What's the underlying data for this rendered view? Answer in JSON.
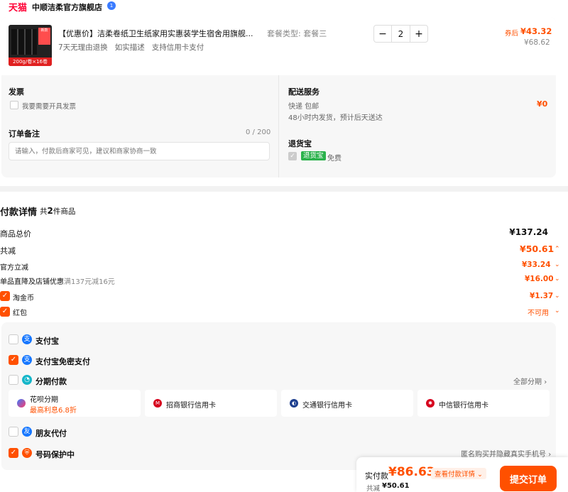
{
  "store": {
    "brand": "天猫",
    "name": "中顺洁柔官方旗舰店",
    "badge": "1"
  },
  "product": {
    "thumb_text": "200g/卷×16卷",
    "title": "【优惠价】洁柔卷纸卫生纸家用实惠装学生宿舍用旗舰...",
    "tags": "7天无理由退换   如实描述   支持信用卡支付",
    "package": "套餐类型: 套餐三",
    "quantity": "2",
    "coupon_label": "券后",
    "price": "¥43.32",
    "orig_price": "¥68.62"
  },
  "invoice": {
    "title": "发票",
    "option": "我要需要开具发票"
  },
  "remark": {
    "title": "订单备注",
    "count": "0 / 200",
    "placeholder": "请输入，付款后商家可见，建议和商家协商一致"
  },
  "delivery": {
    "title": "配送服务",
    "method": "快递 包邮",
    "eta": "48小时内发货，预计后天送达",
    "price": "¥0"
  },
  "return": {
    "title": "退货宝",
    "tag": "退货宝",
    "text": "免费"
  },
  "payment_detail": {
    "title": "付款详情",
    "count_prefix": "共",
    "count": "2",
    "count_suffix": "件商品",
    "rows": [
      {
        "label": "商品总价",
        "value": "¥137.24"
      },
      {
        "label": "共减",
        "value": "¥50.61"
      },
      {
        "label": "官方立减",
        "value": "¥33.24"
      },
      {
        "label": "单品直降及店铺优惠",
        "note": "满137元减16元",
        "value": "¥16.00"
      },
      {
        "label": "淘金币",
        "value": "¥1.37"
      },
      {
        "label": "红包",
        "value": "不可用"
      }
    ]
  },
  "methods": {
    "alipay": "支付宝",
    "alipay_free": "支付宝免密支付",
    "installment": "分期付款",
    "installment_all": "全部分期",
    "banks": [
      {
        "name": "花呗分期",
        "sub": "最高利息6.8折"
      },
      {
        "name": "招商银行信用卡"
      },
      {
        "name": "交通银行信用卡"
      },
      {
        "name": "中信银行信用卡"
      }
    ],
    "friend": "朋友代付",
    "number_protect": "号码保护中",
    "number_note": "匿名购买并隐藏真实手机号"
  },
  "footer": {
    "pay_label": "实付款",
    "pay_amount": "¥86.63",
    "detail_link": "查看付款详情",
    "reduce_label": "共减",
    "reduce_amount": "¥50.61",
    "submit": "提交订单"
  }
}
